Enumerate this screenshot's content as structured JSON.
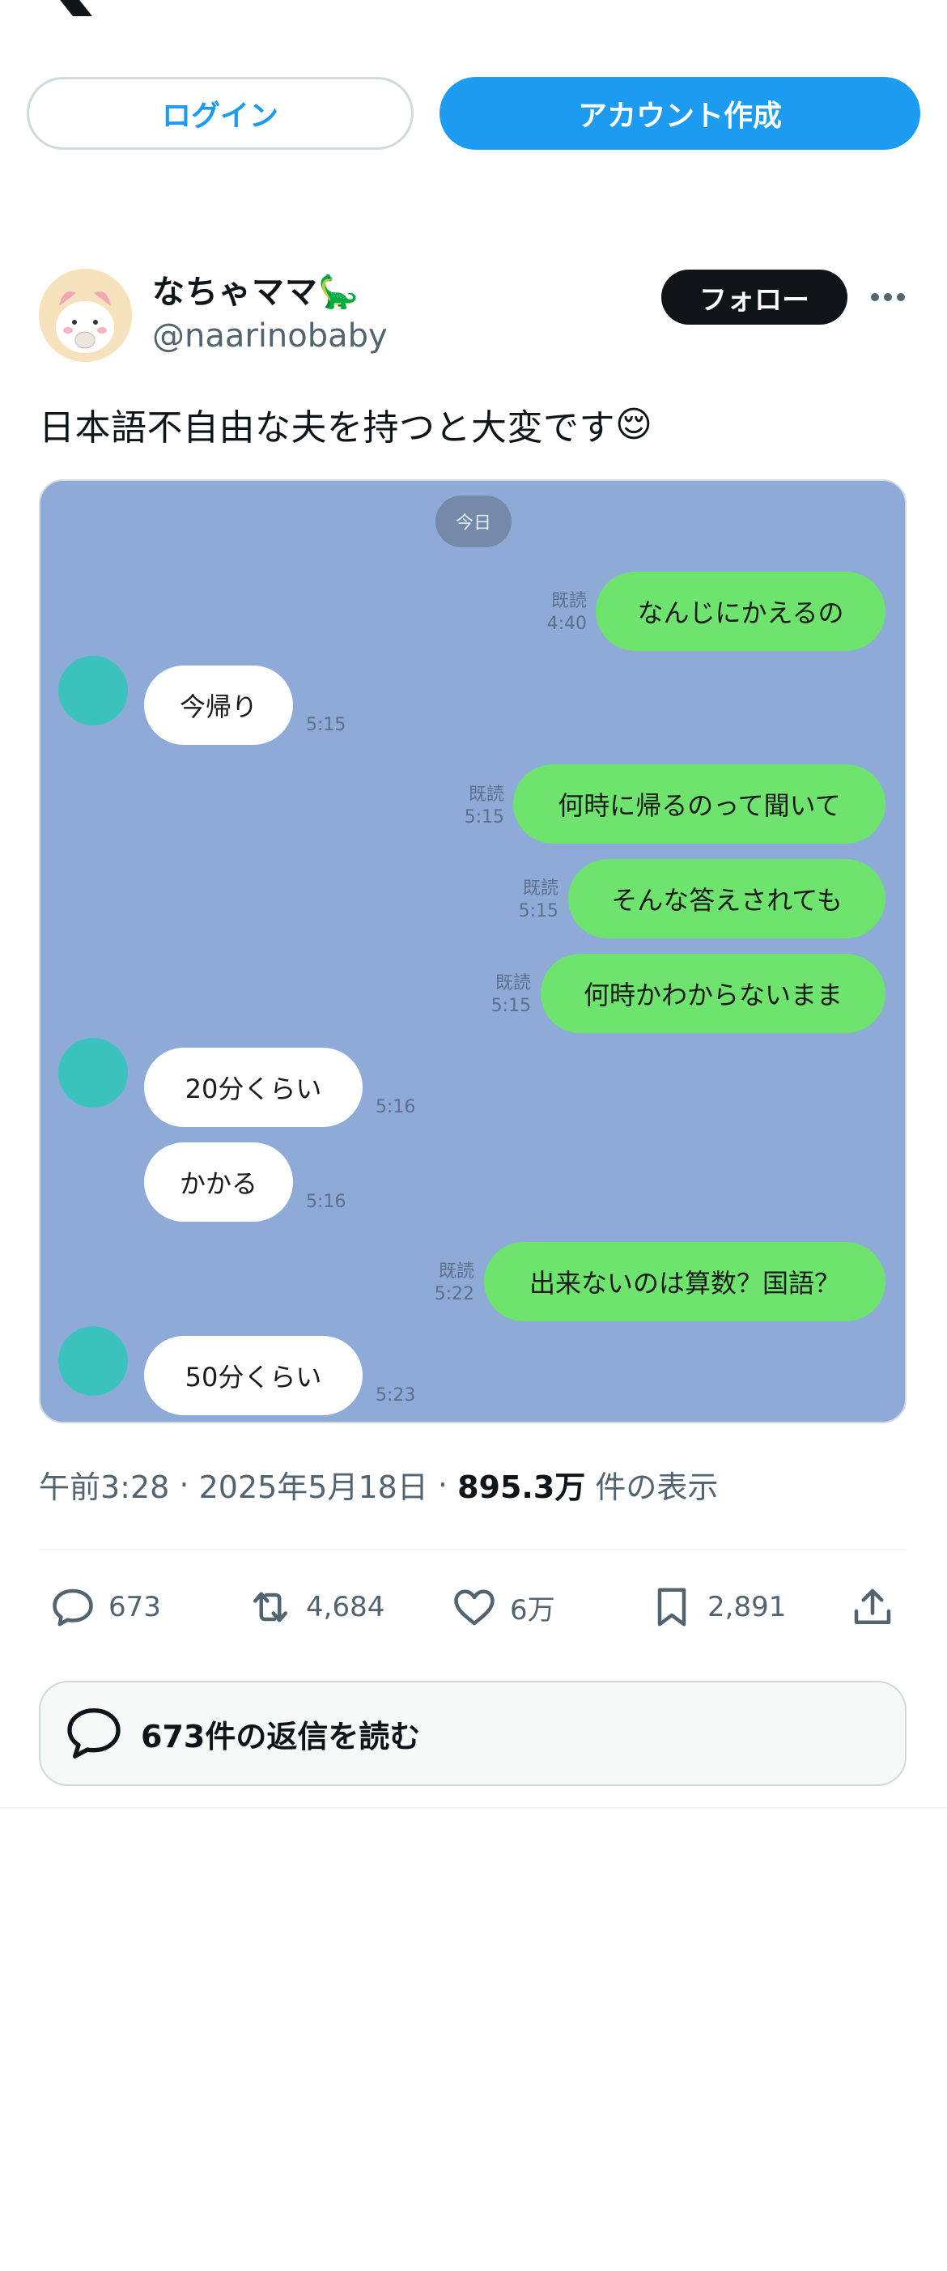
{
  "header": {
    "login_label": "ログイン",
    "signup_label": "アカウント作成"
  },
  "author": {
    "display_name": "なちゃママ🦕",
    "handle": "@naarinobaby",
    "follow_label": "フォロー"
  },
  "tweet": {
    "text": "日本語不自由な夫を持つと大変です",
    "emoji": "😌",
    "time": "午前3:28",
    "date": "2025年5月18日",
    "views_count": "895.3万",
    "views_label": "件の表示"
  },
  "chat": {
    "date_label": "今日",
    "messages": [
      {
        "side": "right",
        "text": "なんじにかえるの",
        "read": "既読",
        "time": "4:40"
      },
      {
        "side": "left",
        "text": "今帰り",
        "time": "5:15"
      },
      {
        "side": "right",
        "text": "何時に帰るのって聞いて",
        "read": "既読",
        "time": "5:15"
      },
      {
        "side": "right",
        "text": "そんな答えされても",
        "read": "既読",
        "time": "5:15"
      },
      {
        "side": "right",
        "text": "何時かわからないまま",
        "read": "既読",
        "time": "5:15"
      },
      {
        "side": "left",
        "text": "20分くらい",
        "time": "5:16"
      },
      {
        "side": "left",
        "text": "かかる",
        "time": "5:16"
      },
      {
        "side": "right",
        "text": "出来ないのは算数？国語？",
        "read": "既読",
        "time": "5:22"
      },
      {
        "side": "left",
        "text": "50分くらい",
        "time": "5:23"
      }
    ]
  },
  "actions": {
    "replies": "673",
    "reposts": "4,684",
    "likes": "6万",
    "bookmarks": "2,891"
  },
  "read_replies_label": "673件の返信を読む",
  "colors": {
    "accent": "#1d9bf0",
    "chat_bg": "#8eabd8",
    "bubble_green": "#6ee36d"
  }
}
